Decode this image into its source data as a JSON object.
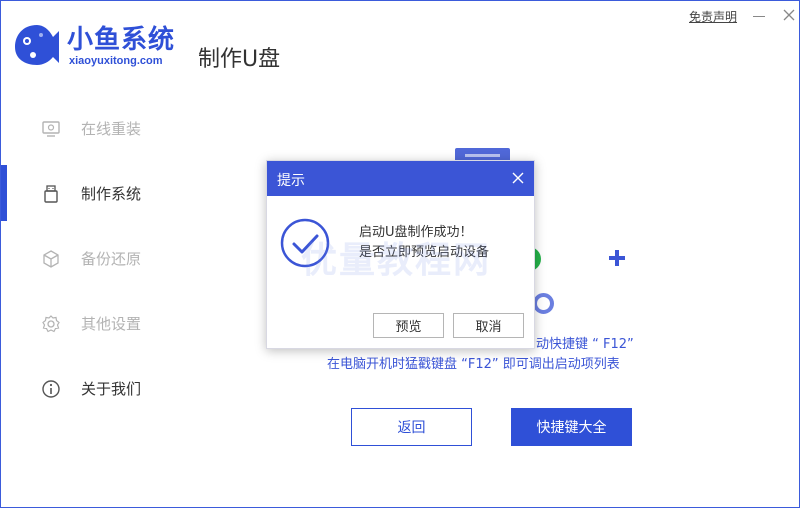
{
  "header": {
    "brand_name": "小鱼系统",
    "brand_url": "xiaoyuxitong.com",
    "page_title": "制作U盘",
    "disclaimer": "免责声明"
  },
  "sidebar": {
    "items": [
      {
        "label": "在线重装",
        "icon": "monitor-icon",
        "state": "disabled"
      },
      {
        "label": "制作系统",
        "icon": "usb-icon",
        "state": "active"
      },
      {
        "label": "备份还原",
        "icon": "cube-icon",
        "state": "disabled"
      },
      {
        "label": "其他设置",
        "icon": "gear-icon",
        "state": "disabled"
      },
      {
        "label": "关于我们",
        "icon": "info-icon",
        "state": "normal"
      }
    ]
  },
  "main": {
    "hint_line_1": "动快捷键 “ F12”",
    "hint_line_2": "在电脑开机时猛戳键盘 “F12” 即可调出启动项列表",
    "back_button": "返回",
    "hotkeys_button": "快捷键大全"
  },
  "watermark": "优量教程网",
  "dialog": {
    "title": "提示",
    "message_line_1": "启动U盘制作成功！",
    "message_line_2": "是否立即预览启动设备",
    "preview_button": "预览",
    "cancel_button": "取消"
  },
  "colors": {
    "accent": "#2f50d7",
    "dialog_header": "#3b55d6",
    "disabled_text": "#b3b3b3",
    "success_green": "#25b24a"
  }
}
